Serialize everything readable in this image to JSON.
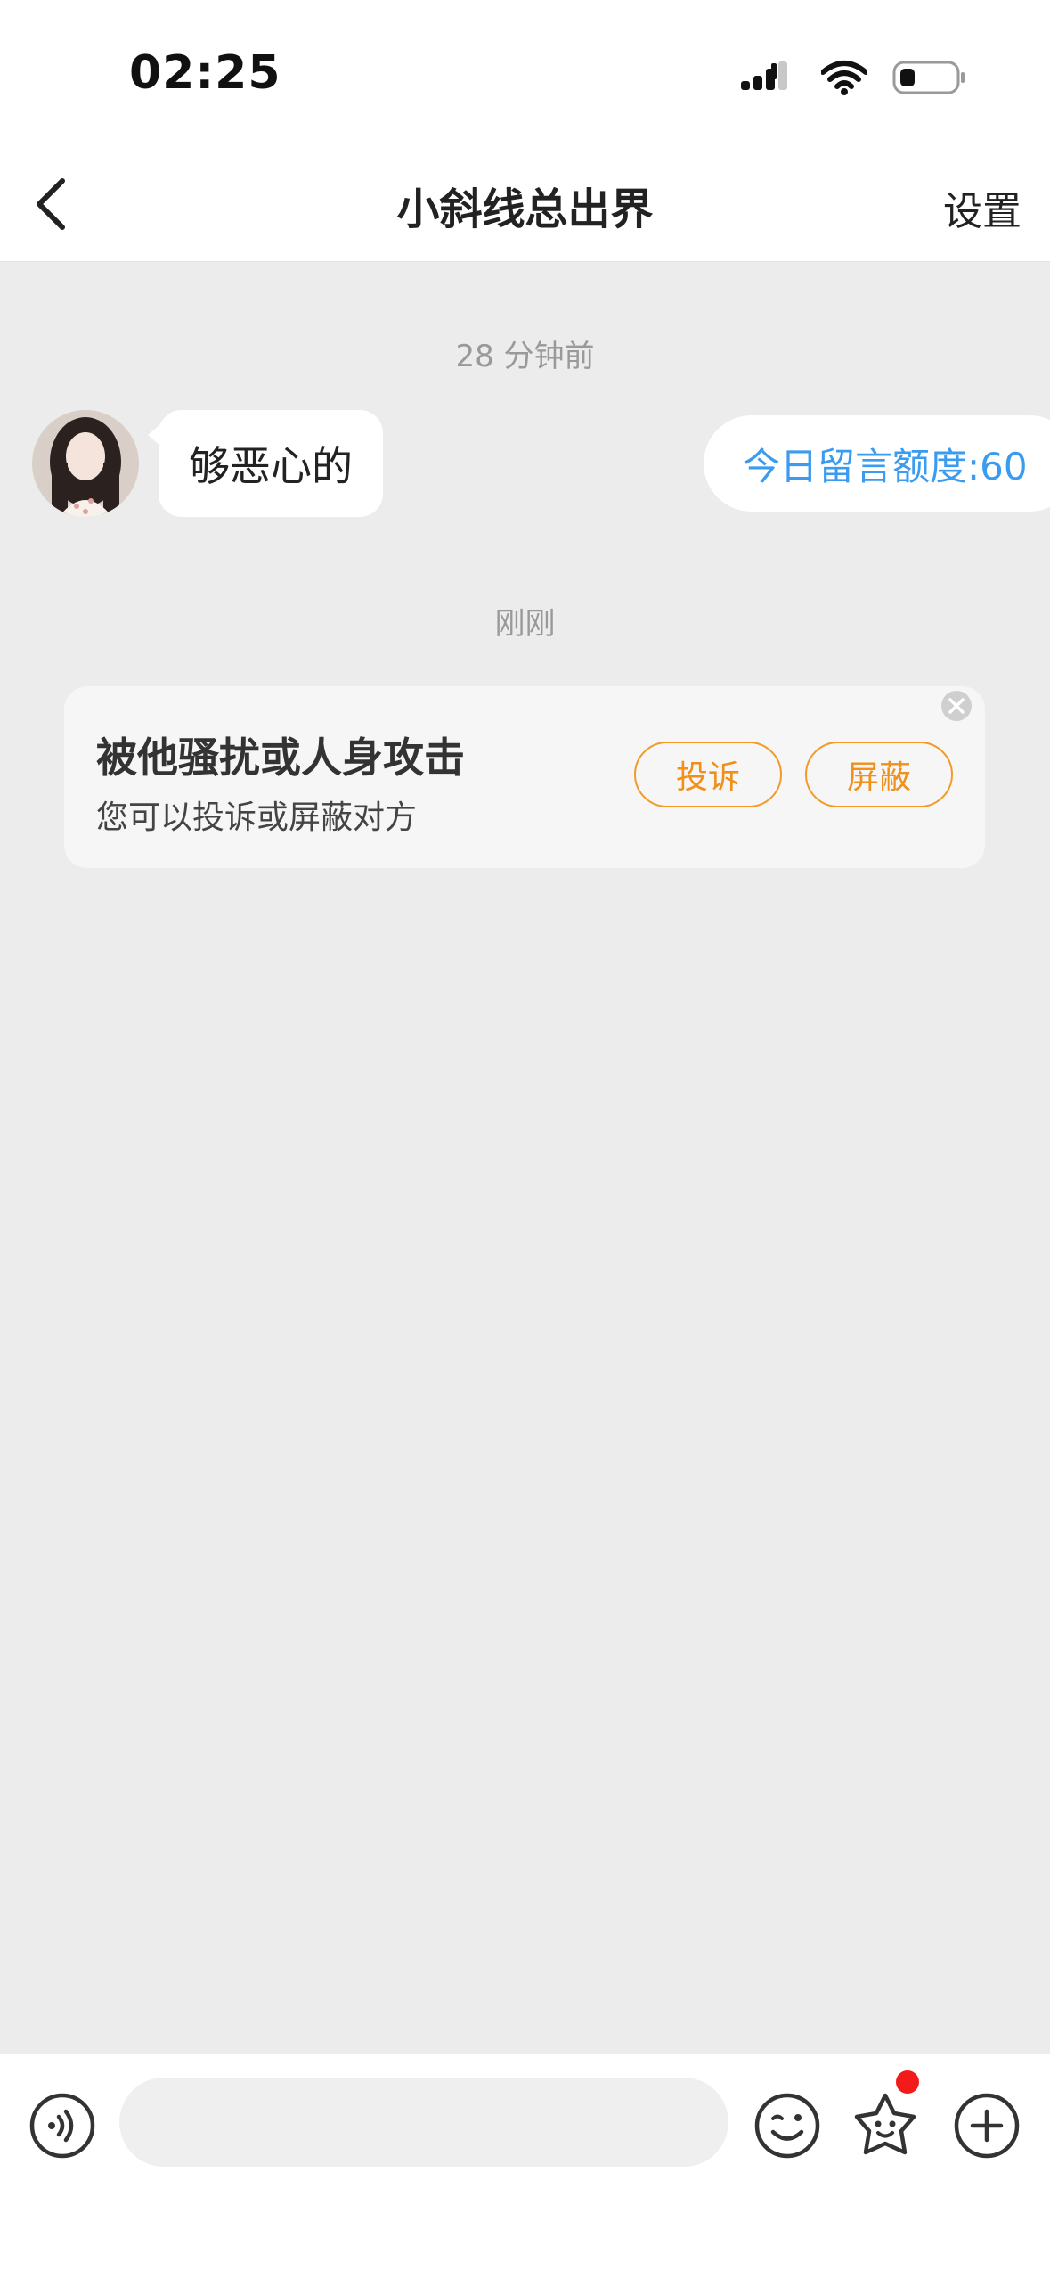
{
  "status_bar": {
    "time": "02:25"
  },
  "header": {
    "title": "小斜线总出界",
    "settings_label": "设置"
  },
  "chat": {
    "timestamp_1": "28 分钟前",
    "message_1": "够恶心的",
    "quota_text": "今日留言额度:60",
    "timestamp_2": "刚刚",
    "harassment_card": {
      "title": "被他骚扰或人身攻击",
      "subtitle": "您可以投诉或屏蔽对方",
      "complain_label": "投诉",
      "block_label": "屏蔽"
    }
  },
  "input_bar": {
    "placeholder": ""
  },
  "colors": {
    "accent_orange": "#f0901b",
    "quota_blue": "#3a9bf0",
    "badge_red": "#f41a1a"
  }
}
